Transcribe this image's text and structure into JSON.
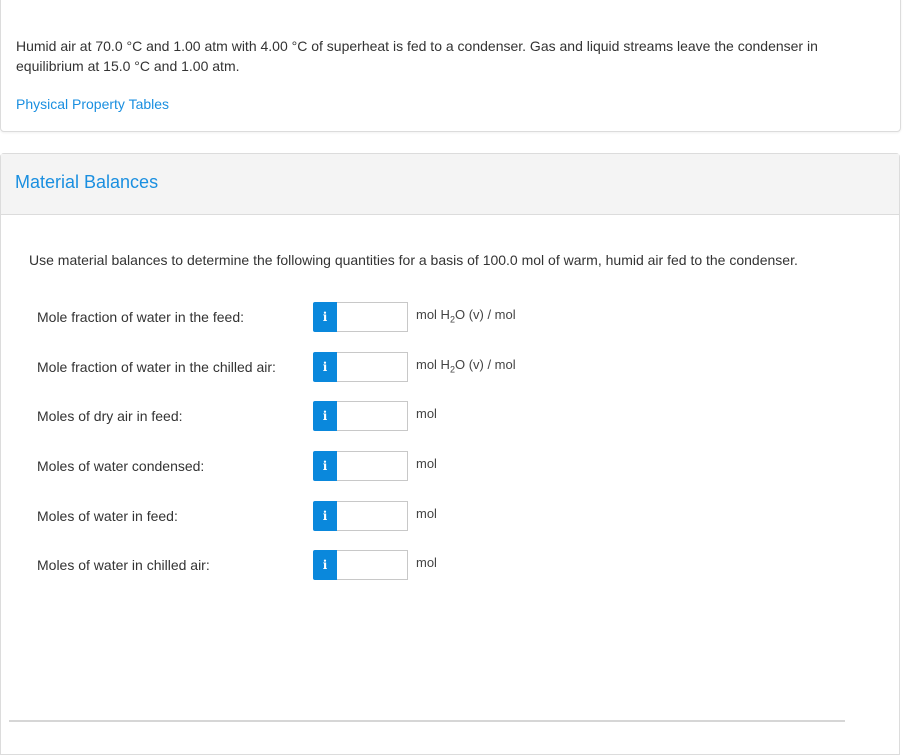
{
  "problem": {
    "statement": "Humid air at 70.0 °C and 1.00 atm with 4.00 °C of superheat is fed to a condenser. Gas and liquid streams leave the condenser in equilibrium at 15.0 °C and 1.00 atm.",
    "link_label": "Physical Property Tables"
  },
  "section": {
    "title": "Material Balances",
    "instructions": "Use material balances to determine the following quantities for a basis of 100.0 mol of warm, humid air fed to the condenser.",
    "info_icon": "info-icon",
    "questions": [
      {
        "label": "Mole fraction of water in the feed:",
        "value": "",
        "unit_pre": "mol H",
        "unit_sub": "2",
        "unit_post": "O (v) / mol"
      },
      {
        "label": "Mole fraction of water in the chilled air:",
        "value": "",
        "unit_pre": "mol H",
        "unit_sub": "2",
        "unit_post": "O (v) / mol"
      },
      {
        "label": "Moles of dry air in feed:",
        "value": "",
        "unit_pre": "mol",
        "unit_sub": "",
        "unit_post": ""
      },
      {
        "label": "Moles of water condensed:",
        "value": "",
        "unit_pre": "mol",
        "unit_sub": "",
        "unit_post": ""
      },
      {
        "label": "Moles of water in feed:",
        "value": "",
        "unit_pre": "mol",
        "unit_sub": "",
        "unit_post": ""
      },
      {
        "label": "Moles of water in chilled air:",
        "value": "",
        "unit_pre": "mol",
        "unit_sub": "",
        "unit_post": ""
      }
    ]
  },
  "icons": {
    "info_glyph": "i"
  }
}
